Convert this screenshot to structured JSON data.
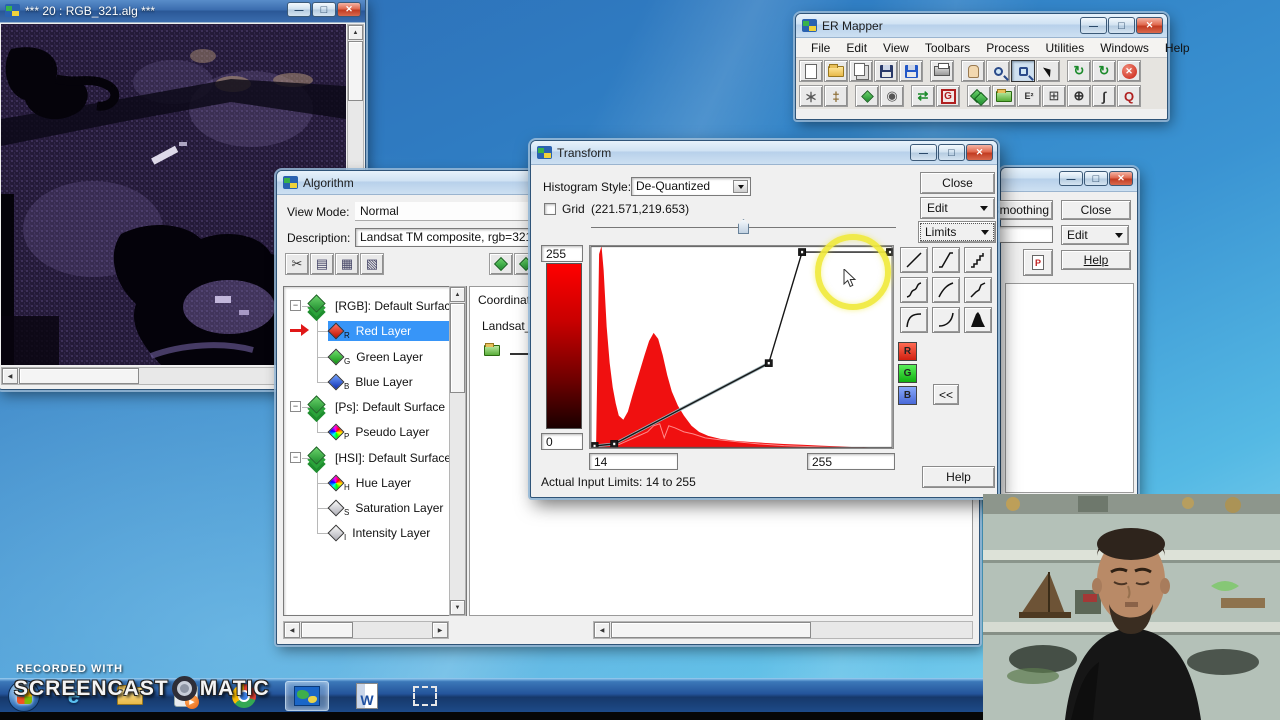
{
  "colors": {
    "histogram_red": "#f01010",
    "histogram_outline": "#ff8a8a",
    "curve_black": "#161616",
    "curve_gray_underlay": "#9bb0b6",
    "selection_blue": "#3795f8",
    "highlight_yellow": "#f0e93c"
  },
  "image_window": {
    "title": "*** 20 : RGB_321.alg ***"
  },
  "er_mapper": {
    "title": "ER Mapper",
    "menus": [
      "File",
      "Edit",
      "View",
      "Toolbars",
      "Process",
      "Utilities",
      "Windows",
      "Help"
    ],
    "toolbar_row1": [
      "new-page",
      "open-folder",
      "copy-pages",
      "save-disk",
      "save-as-disk",
      "print",
      "pan-hand",
      "zoom-magnifier",
      "zoom-box",
      "pointer-arrow",
      "refresh-image",
      "refresh-transform",
      "stop"
    ],
    "toolbar_row2": [
      "edit-wand",
      "measure-tool",
      "annotate-shape",
      "cellvalue-probe",
      "image-to-dataset",
      "geocode-grid",
      "algorithm-sheets",
      "open-algorithm-folder",
      "formula-editor",
      "page-setup-grid",
      "geolink-target",
      "transform-curve",
      "quick-zoom"
    ]
  },
  "algorithm": {
    "title": "Algorithm",
    "view_mode_label": "View Mode:",
    "view_mode_value": "Normal",
    "description_label": "Description:",
    "description_value": "Landsat TM composite, rgb=321",
    "toolbar": [
      "cut",
      "copy",
      "paste",
      "paste-layer"
    ],
    "toolbar_right": [
      "save-dataset",
      "load-dataset"
    ],
    "coordinate_label": "Coordinate S",
    "dataset_name": "Landsat_TM",
    "tree": [
      {
        "label": "[RGB]: Default Surface",
        "icon": "surface-stack",
        "expander": true,
        "selected": false,
        "pointer": false
      },
      {
        "label": "Red Layer",
        "icon": "red-diamond",
        "badge": "R",
        "expander": false,
        "selected": true,
        "pointer": true
      },
      {
        "label": "Green Layer",
        "icon": "green-diamond",
        "badge": "G",
        "expander": false,
        "selected": false,
        "pointer": false
      },
      {
        "label": "Blue Layer",
        "icon": "blue-diamond",
        "badge": "B",
        "expander": false,
        "selected": false,
        "pointer": false
      },
      {
        "label": "[Ps]: Default Surface",
        "icon": "surface-stack",
        "expander": true,
        "selected": false,
        "pointer": false
      },
      {
        "label": "Pseudo Layer",
        "icon": "rainbow-diamond",
        "badge": "P",
        "expander": false,
        "selected": false,
        "pointer": false
      },
      {
        "label": "[HSI]: Default Surface",
        "icon": "surface-stack",
        "expander": true,
        "selected": false,
        "pointer": false
      },
      {
        "label": "Hue Layer",
        "icon": "rainbow-diamond",
        "badge": "H",
        "expander": false,
        "selected": false,
        "pointer": false
      },
      {
        "label": "Saturation Layer",
        "icon": "gray-diamond",
        "badge": "S",
        "expander": false,
        "selected": false,
        "pointer": false
      },
      {
        "label": "Intensity Layer",
        "icon": "gray-diamond",
        "badge": "I",
        "expander": false,
        "selected": false,
        "pointer": false
      }
    ]
  },
  "transform": {
    "title": "Transform",
    "histogram_style_label": "Histogram Style:",
    "histogram_style_value": "De-Quantized",
    "grid_label": "Grid",
    "grid_coords": "(221.571,219.653)",
    "range_max": "255",
    "range_min": "0",
    "input_min": "14",
    "input_max": "255",
    "actual_limits": "Actual Input Limits: 14 to 255",
    "buttons": {
      "close": "Close",
      "edit": "Edit",
      "limits": "Limits",
      "help": "Help"
    },
    "collapse_label": "<<",
    "rgb_buttons": [
      "R",
      "G",
      "B"
    ],
    "presets": [
      "linear",
      "steep-linear",
      "steps",
      "s-curve",
      "gamma-curve",
      "piecewise",
      "log-curve",
      "inverse-log",
      "histogram-equalize"
    ],
    "chart_data": {
      "type": "area",
      "title": "Red Layer input histogram with transform curve",
      "x_range": [
        0,
        255
      ],
      "y_range": [
        0,
        255
      ],
      "input_limits": [
        14,
        255
      ],
      "output_limits": [
        0,
        255
      ],
      "histogram_points_pct": [
        [
          2,
          0
        ],
        [
          3,
          96
        ],
        [
          3.8,
          100
        ],
        [
          4.5,
          88
        ],
        [
          5.5,
          60
        ],
        [
          6.5,
          42
        ],
        [
          7.5,
          30
        ],
        [
          8.5,
          22
        ],
        [
          9.5,
          16
        ],
        [
          11,
          14
        ],
        [
          12.5,
          18
        ],
        [
          14,
          26
        ],
        [
          16,
          36
        ],
        [
          18,
          46
        ],
        [
          19.5,
          53
        ],
        [
          21,
          57
        ],
        [
          22.5,
          54
        ],
        [
          24,
          46
        ],
        [
          25.5,
          36
        ],
        [
          27,
          28
        ],
        [
          29,
          21
        ],
        [
          31,
          16
        ],
        [
          33.5,
          11
        ],
        [
          36,
          8
        ],
        [
          39,
          6
        ],
        [
          43,
          4.5
        ],
        [
          48,
          3.5
        ],
        [
          53,
          3
        ],
        [
          58,
          2.5
        ],
        [
          64,
          2
        ],
        [
          70,
          1.6
        ],
        [
          76,
          1.2
        ],
        [
          82,
          0.8
        ],
        [
          88,
          0.4
        ],
        [
          92,
          0
        ]
      ],
      "outline_points_pct": [
        [
          7,
          0
        ],
        [
          10,
          2
        ],
        [
          13,
          4
        ],
        [
          16,
          6
        ],
        [
          19,
          8
        ],
        [
          21,
          11
        ],
        [
          23,
          12
        ],
        [
          24.5,
          5
        ],
        [
          26,
          11
        ],
        [
          28,
          10
        ],
        [
          31,
          8
        ],
        [
          34,
          7
        ],
        [
          38,
          5
        ],
        [
          43,
          4
        ],
        [
          49,
          3
        ],
        [
          56,
          2
        ],
        [
          64,
          1.2
        ],
        [
          74,
          0.6
        ],
        [
          84,
          0.2
        ],
        [
          90,
          0
        ]
      ],
      "curve_points_pct": [
        [
          1.5,
          1
        ],
        [
          8,
          2
        ],
        [
          59,
          42
        ],
        [
          70,
          97
        ],
        [
          99,
          97
        ]
      ]
    }
  },
  "behind_window": {
    "smoothing": "Smoothing",
    "close": "Close",
    "edit": "Edit",
    "help": "Help"
  },
  "watermark": {
    "line1": "RECORDED WITH",
    "brand_left": "SCREENCAST",
    "brand_right": "MATIC"
  },
  "taskbar": {
    "icons": [
      "start-orb",
      "internet-explorer",
      "windows-explorer-folder",
      "screencast-o-matic",
      "google-chrome",
      "er-mapper-active",
      "microsoft-word",
      "snipping-tool"
    ]
  }
}
